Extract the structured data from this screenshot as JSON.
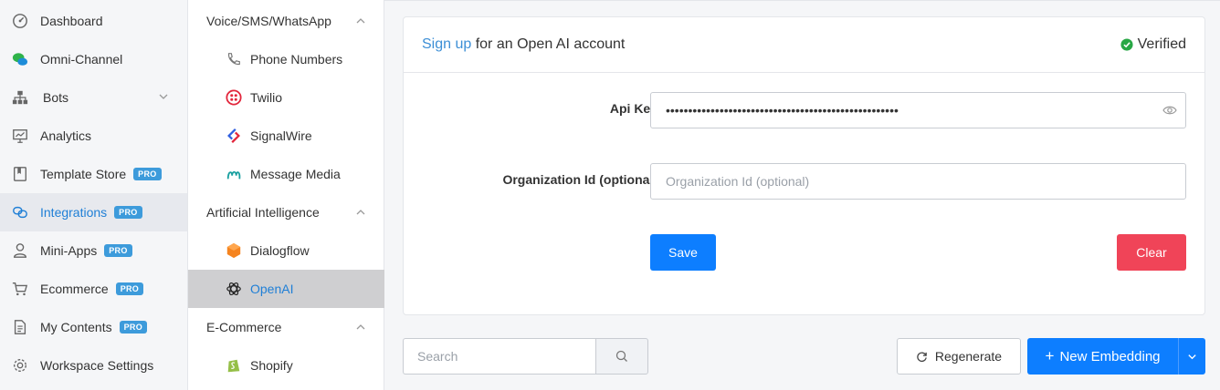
{
  "sidebar": {
    "items": [
      {
        "label": "Dashboard",
        "icon": "dashboard-icon"
      },
      {
        "label": "Omni-Channel",
        "icon": "chat-bubbles-icon"
      },
      {
        "label": "Bots",
        "icon": "org-chart-icon"
      },
      {
        "label": "Analytics",
        "icon": "presentation-chart-icon"
      },
      {
        "label": "Template Store",
        "icon": "book-icon",
        "badge": "PRO"
      },
      {
        "label": "Integrations",
        "icon": "link-icon",
        "badge": "PRO",
        "active": true
      },
      {
        "label": "Mini-Apps",
        "icon": "user-icon",
        "badge": "PRO"
      },
      {
        "label": "Ecommerce",
        "icon": "cart-icon",
        "badge": "PRO"
      },
      {
        "label": "My Contents",
        "icon": "document-icon",
        "badge": "PRO"
      },
      {
        "label": "Workspace Settings",
        "icon": "gear-icon"
      }
    ]
  },
  "subnav": {
    "groups": [
      {
        "label": "Voice/SMS/WhatsApp",
        "items": [
          "Phone Numbers",
          "Twilio",
          "SignalWire",
          "Message Media"
        ]
      },
      {
        "label": "Artificial Intelligence",
        "items": [
          "Dialogflow",
          "OpenAI"
        ]
      },
      {
        "label": "E-Commerce",
        "items": [
          "Shopify"
        ]
      }
    ],
    "active_item": "OpenAI"
  },
  "card": {
    "title_link": "Sign up",
    "title_rest": " for an Open AI account",
    "status": "Verified",
    "api_key_label": "Api Key",
    "api_key_value": "••••••••••••••••••••••••••••••••••••••••••••••••••••",
    "org_label": "Organization Id (optional)",
    "org_placeholder": "Organization Id (optional)",
    "save_label": "Save",
    "clear_label": "Clear"
  },
  "toolbar": {
    "search_placeholder": "Search",
    "regenerate_label": "Regenerate",
    "new_embedding_label": "New Embedding"
  },
  "colors": {
    "primary": "#0d7eff",
    "danger": "#f04458",
    "link": "#3d8fd6",
    "success": "#28a745",
    "pro_badge": "#3d9bdb"
  }
}
